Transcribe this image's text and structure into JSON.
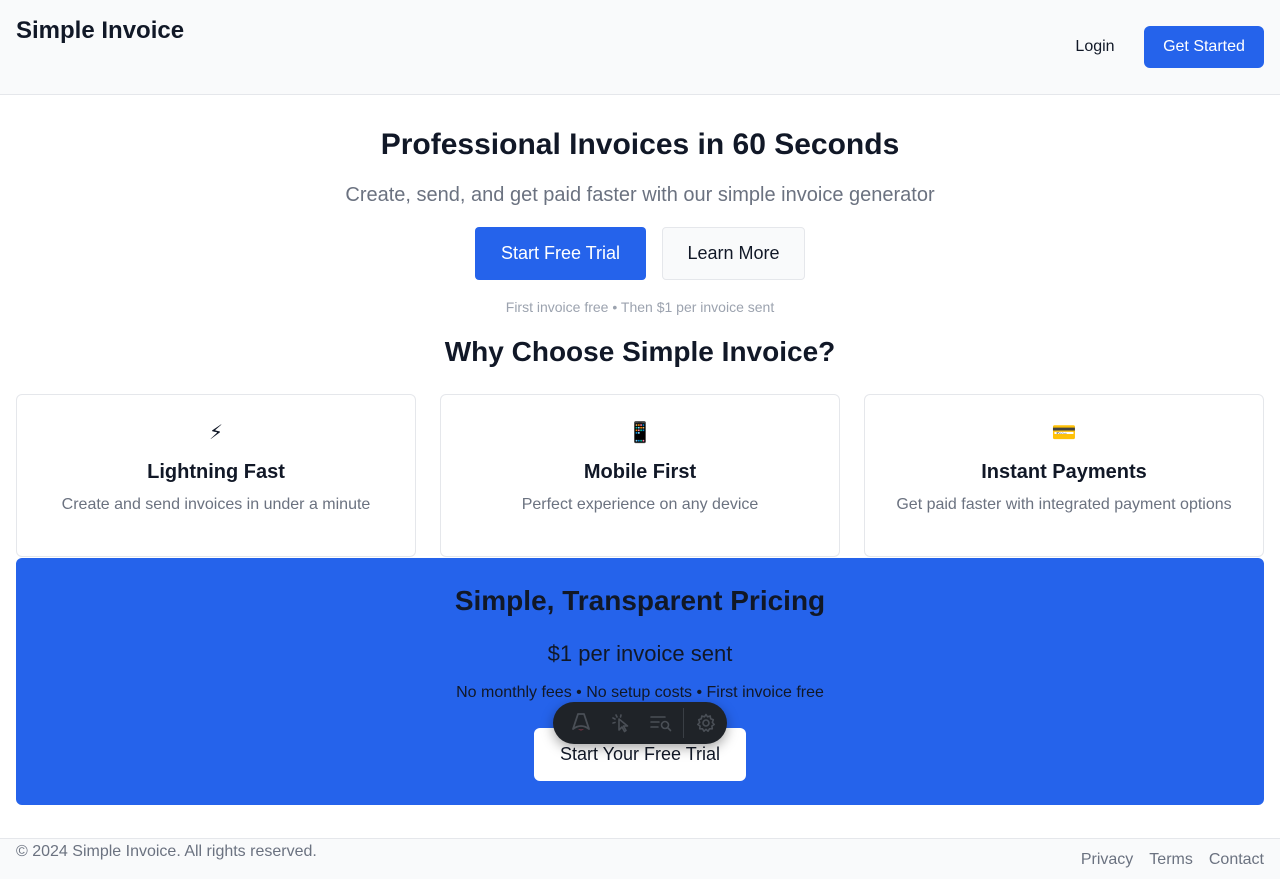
{
  "header": {
    "brand": "Simple Invoice",
    "login_label": "Login",
    "cta_label": "Get Started"
  },
  "hero": {
    "title": "Professional Invoices in 60 Seconds",
    "subtitle": "Create, send, and get paid faster with our simple invoice generator",
    "primary_label": "Start Free Trial",
    "secondary_label": "Learn More",
    "note": "First invoice free • Then $1 per invoice sent"
  },
  "features": {
    "title": "Why Choose Simple Invoice?",
    "items": [
      {
        "icon": "⚡",
        "icon_name": "lightning-icon",
        "title": "Lightning Fast",
        "desc": "Create and send invoices in under a minute"
      },
      {
        "icon": "📱",
        "icon_name": "mobile-phone-icon",
        "title": "Mobile First",
        "desc": "Perfect experience on any device"
      },
      {
        "icon": "💳",
        "icon_name": "credit-card-icon",
        "title": "Instant Payments",
        "desc": "Get paid faster with integrated payment options"
      }
    ]
  },
  "pricing": {
    "title": "Simple, Transparent Pricing",
    "price": "$1 per invoice sent",
    "note": "No monthly fees • No setup costs • First invoice free",
    "cta_label": "Start Your Free Trial"
  },
  "footer": {
    "copyright": "© 2024 Simple Invoice. All rights reserved.",
    "links": [
      "Privacy",
      "Terms",
      "Contact"
    ]
  },
  "colors": {
    "accent": "#2563eb",
    "text": "#111827",
    "muted": "#6b7280",
    "border": "#e5e7eb"
  }
}
